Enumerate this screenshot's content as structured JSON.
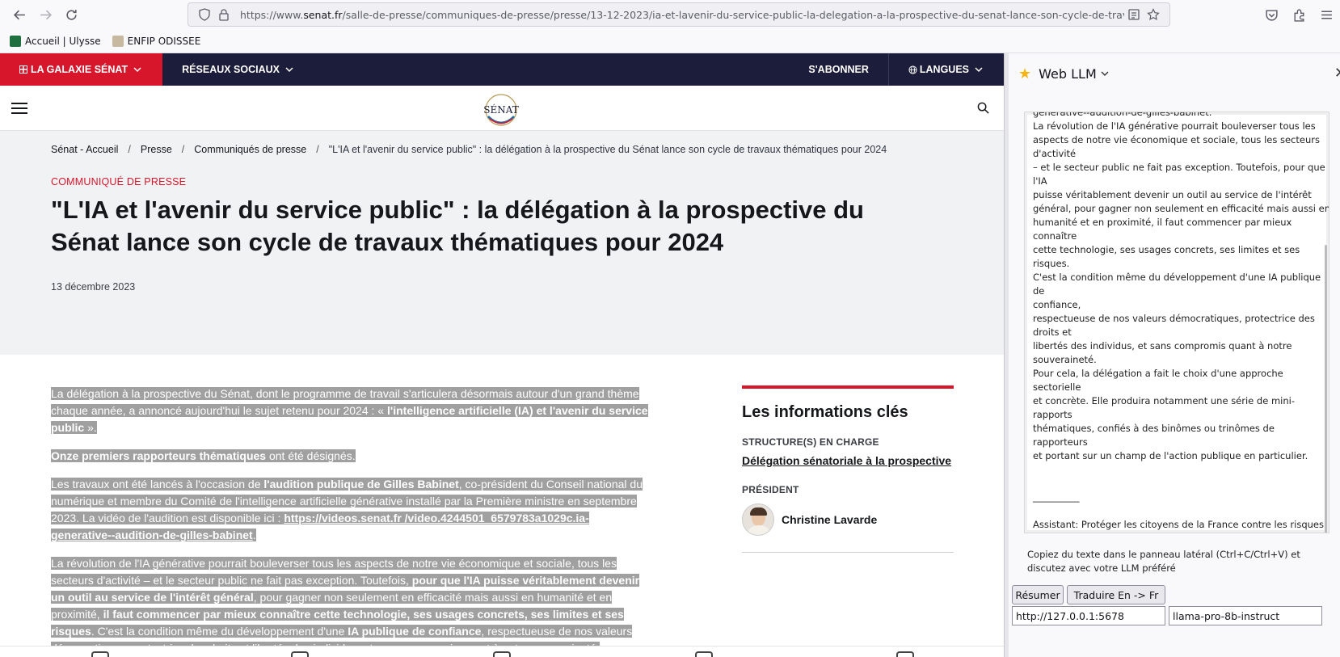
{
  "browser": {
    "url_prefix": "https://www.",
    "url_host": "senat.fr",
    "url_path": "/salle-de-presse/communiques-de-presse/presse/13-12-2023/ia-et-lavenir-du-service-public-la-delegation-a-la-prospective-du-senat-lance-son-cycle-de-travaux-them",
    "bookmarks": [
      {
        "label": "Accueil | Ulysse",
        "color": "#1f6f3f"
      },
      {
        "label": "ENFIP ODISSEE",
        "color": "#c7b9a0"
      }
    ]
  },
  "site": {
    "topbar": {
      "galaxie": "LA GALAXIE SÉNAT",
      "reseaux": "RÉSEAUX SOCIAUX",
      "abonner": "S'ABONNER",
      "langues": "LANGUES"
    },
    "logo_text": "SÉNAT",
    "accent_color": "#d8162b",
    "topbar_color": "#1c1d3b"
  },
  "hero": {
    "breadcrumb": [
      "Sénat - Accueil",
      "Presse",
      "Communiqués de presse"
    ],
    "breadcrumb_current": "\"L'IA et l'avenir du service public\" : la délégation à la prospective du Sénat lance son cycle de travaux thématiques pour 2024",
    "kicker": "COMMUNIQUÉ DE PRESSE",
    "title": "\"L'IA et l'avenir du service public\" : la délégation à la prospective du Sénat lance son cycle de travaux thématiques pour 2024",
    "date": "13 décembre 2023"
  },
  "article": {
    "p1_a": "La délégation à la prospective du Sénat, dont le programme de travail s'articulera désormais autour d'un grand thème chaque année, a annoncé aujourd'hui le sujet retenu pour 2024 : « ",
    "p1_b": "l'intelligence artificielle (IA) et l'avenir du service public",
    "p1_c": " ».",
    "p2_a": "Onze premiers rapporteurs thématiques",
    "p2_b": " ont été désignés.",
    "p3_a": "Les travaux ont été lancés à l'occasion de ",
    "p3_b": "l'audition publique de Gilles Babinet",
    "p3_c": ", co-président du Conseil national du numérique et membre du Comité de l'intelligence artificielle générative installé par la Première ministre en septembre 2023. La vidéo de l'audition est disponible ici : ",
    "p3_link": "https://videos.senat.fr /video.4244501_6579783a1029c.ia-generative--audition-de-gilles-babinet",
    "p3_d": ".",
    "p4_a": "La révolution de l'IA générative pourrait bouleverser tous les aspects de notre vie économique et sociale, tous les secteurs d'activité – et le secteur public ne fait pas exception. Toutefois, ",
    "p4_b": "pour que l'IA puisse véritablement devenir un outil au service de l'intérêt général",
    "p4_c": ", pour gagner non seulement en efficacité mais aussi en humanité et en proximité, ",
    "p4_d": "il faut commencer par mieux connaître cette technologie, ses usages concrets, ses limites et ses risques",
    "p4_e": ". C'est la condition même du développement d'une ",
    "p4_f": "IA publique de confiance",
    "p4_g": ", respectueuse de nos valeurs démocratiques, protectrice des droits et libertés des individus, et sans compromis quant à notre souveraineté."
  },
  "key_info": {
    "title": "Les informations clés",
    "structure_label": "STRUCTURE(S) EN CHARGE",
    "structure_value": "Délégation sénatoriale à la prospective",
    "president_label": "PRÉSIDENT",
    "president_name": "Christine Lavarde"
  },
  "side_panel": {
    "title": "Web LLM",
    "chat_text": "generative--audition-de-gilles-babinet.\nLa révolution de l'IA générative pourrait bouleverser tous les\naspects de notre vie économique et sociale, tous les secteurs\nd'activité\n– et le secteur public ne fait pas exception. Toutefois, pour que l'IA\npuisse véritablement devenir un outil au service de l'intérêt\ngénéral, pour gagner non seulement en efficacité mais aussi en\nhumanité et en proximité, il faut commencer par mieux connaître\ncette technologie, ses usages concrets, ses limites et ses risques.\nC'est la condition même du développement d'une IA publique de\nconfiance,\nrespectueuse de nos valeurs démocratiques, protectrice des\ndroits et\nlibertés des individus, et sans compromis quant à notre\nsouveraineté.\nPour cela, la délégation a fait le choix d'une approche sectorielle\net concrète. Elle produira notamment une série de mini-rapports\nthématiques, confiés à des binômes ou trinômes de rapporteurs\net portant sur un champ de l'action publique en particulier.\n\n\n__________\n\nAssistant: Protéger les citoyens de la France contre les risques\npotentiels de l'IA est un enjeu majeur pour le Sénat, qui a donc\ndécidé d'investir une partie de son temps et de ses ressources\ndans ce domaine. Les travaux se feront au moyen de mini-\nrapports thématiques, produits par des binômes ou trinômes de\nrapporteurs chargés d'étudier un champ de l'action publique en\nparticulier. Ces reports seront axés sur la manière dont l'IA peut\nrévolutionner les différents secteurs de notre économie et",
    "hint": "Copiez du texte dans le panneau latéral (Ctrl+C/Ctrl+V) et discutez avec votre LLM préféré",
    "btn_summarize": "Résumer",
    "btn_translate": "Traduire En -> Fr",
    "server_url": "http://127.0.0.1:5678",
    "model_name": "llama-pro-8b-instruct"
  }
}
